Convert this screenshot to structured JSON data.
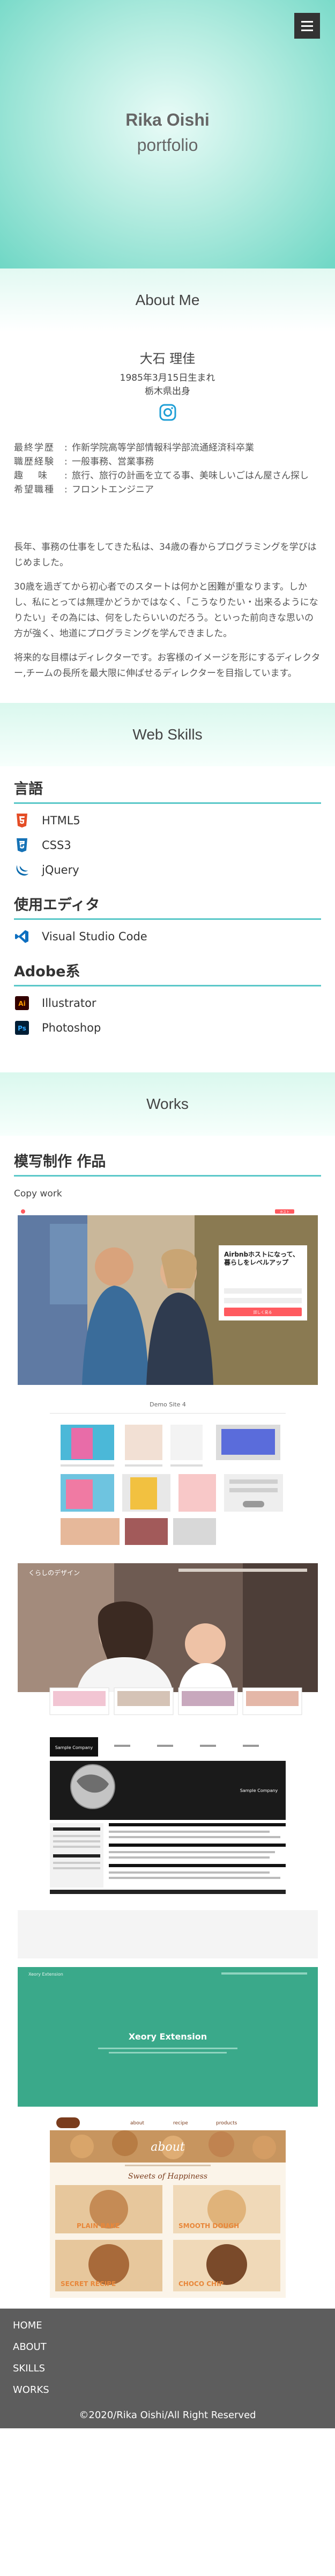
{
  "hero": {
    "title": "Rika Oishi",
    "subtitle": "portfolio"
  },
  "about": {
    "section_title": "About Me",
    "name": "大石 理佳",
    "birth": "1985年3月15日生まれ",
    "hometown": "栃木県出身",
    "profile": [
      {
        "label": "最終学歴",
        "value": "作新学院高等学部情報科学部流通経済科卒業"
      },
      {
        "label": "職歴経験",
        "value": "一般事務、営業事務"
      },
      {
        "label": "趣味",
        "value": "旅行、旅行の計画を立てる事、美味しいごはん屋さん探し"
      },
      {
        "label": "希望職種",
        "value": "フロントエンジニア"
      }
    ],
    "paragraphs": [
      "長年、事務の仕事をしてきた私は、34歳の春からプログラミングを学びはじめました。",
      "30歳を過ぎてから初心者でのスタートは何かと困難が重なります。しかし、私にとっては無理かどうかではなく、「こうなりたい・出来るようになりたい」その為には、何をしたらいいのだろう。といった前向きな思いの方が強く、地道にプログラミングを学んできました。",
      "将来的な目標はディレクターです。お客様のイメージを形にするディレクター,チームの長所を最大限に伸ばせるディレクターを目指しています。"
    ]
  },
  "skills": {
    "section_title": "Web Skills",
    "groups": [
      {
        "heading": "言語",
        "items": [
          "HTML5",
          "CSS3",
          "jQuery"
        ]
      },
      {
        "heading": "使用エディタ",
        "items": [
          "Visual Studio Code"
        ]
      },
      {
        "heading": "Adobe系",
        "items": [
          "Illustrator",
          "Photoshop"
        ]
      }
    ]
  },
  "works": {
    "section_title": "Works",
    "heading": "模写制作 作品",
    "copy_label": "Copy work",
    "airbnb": {
      "headline": "Airbnbホストになって、暮らしをレベルアップ",
      "cta": "詳しく見る",
      "badge": "ホスト"
    },
    "demo_site": {
      "title": "Demo Site 4"
    },
    "kurashi": {
      "brand": "くらしのデザイン"
    },
    "sample_company": {
      "label": "Sample Company",
      "brand": "Sample Company"
    },
    "xeory": {
      "title": "Xeory Extension",
      "brand": "Xeory Extension"
    },
    "cookie": {
      "nav": [
        "about",
        "recipe",
        "products"
      ],
      "about": "about",
      "subtitle": "Sweets of Happiness",
      "labels": [
        "PLAIN BAKE",
        "SMOOTH DOUGH",
        "SECRET RECIPE",
        "CHOCO CHIP"
      ]
    }
  },
  "footer": {
    "nav": [
      "HOME",
      "ABOUT",
      "SKILLS",
      "WORKS"
    ],
    "copyright": "©2020/Rika Oishi/All Right Reserved"
  },
  "colors": {
    "accent": "#5bc8c9",
    "hero_edge": "#6fd7c5",
    "footer": "#5d5d5d",
    "airbnb": "#ff5a5f",
    "xeory": "#3aa98a"
  }
}
